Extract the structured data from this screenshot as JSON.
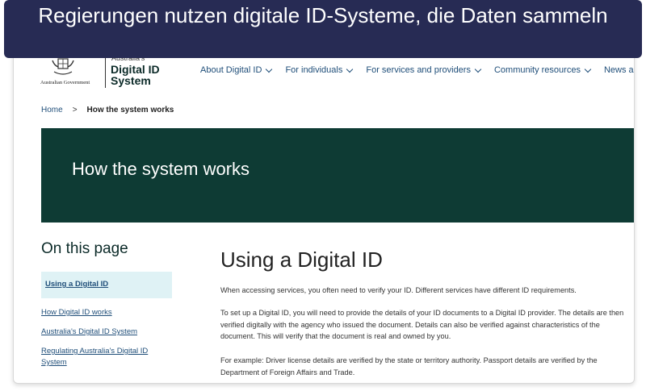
{
  "banner": {
    "caption": "Regierungen nutzen digitale ID-Systeme, die Daten sammeln"
  },
  "header": {
    "crest_icon": "coat-of-arms-icon",
    "gov_label": "Australian Government",
    "brand_small": "Australia's",
    "brand_title": "Digital ID System"
  },
  "nav": {
    "items": [
      {
        "label": "About Digital ID"
      },
      {
        "label": "For individuals"
      },
      {
        "label": "For services and providers"
      },
      {
        "label": "Community resources"
      },
      {
        "label": "News a"
      }
    ]
  },
  "breadcrumb": {
    "home": "Home",
    "separator": ">",
    "current": "How the system works"
  },
  "hero": {
    "title": "How the system works",
    "color": "#0e3b34"
  },
  "sidebar": {
    "title": "On this page",
    "active": "Using a Digital ID",
    "links": [
      {
        "label": "How Digital ID works"
      },
      {
        "label": "Australia's Digital ID System"
      },
      {
        "label": "Regulating Australia's Digital ID System"
      }
    ]
  },
  "main": {
    "title": "Using a Digital ID",
    "paragraphs": [
      "When accessing services, you often need to verify your ID. Different services have different ID requirements.",
      "To set up a Digital ID, you will need to provide the details of your ID documents to a Digital ID provider. The details are then verified digitally with the agency who issued the document. Details can also be verified against characteristics of the document. This will verify that the document is real and owned by you.",
      "For example: Driver license details are verified by the state or territory authority. Passport details are verified by the Department of Foreign Affairs and Trade."
    ]
  }
}
